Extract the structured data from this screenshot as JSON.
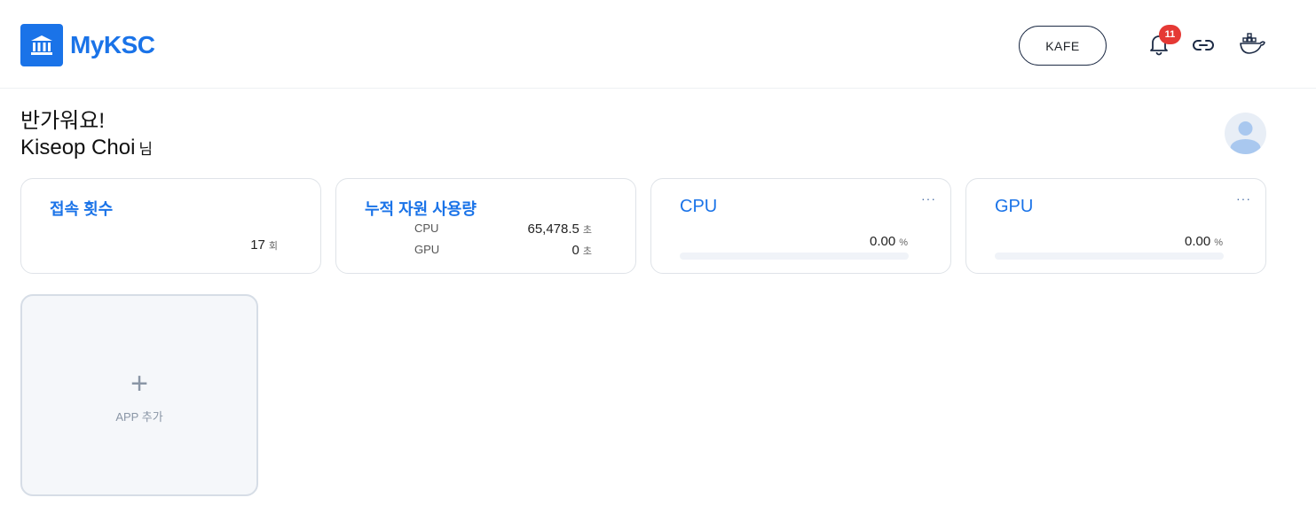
{
  "header": {
    "logo_text": "MyKSC",
    "project_label": "KAFE",
    "notification_count": "11",
    "icons": [
      "bank-icon",
      "bell-icon",
      "link-icon",
      "docker-icon"
    ]
  },
  "greeting": {
    "hello": "반가워요!",
    "user_name": "Kiseop Choi",
    "honorific": "님"
  },
  "cards": {
    "access": {
      "title": "접속 횟수",
      "value": "17",
      "unit": "회"
    },
    "usage": {
      "title": "누적 자원 사용량",
      "rows": [
        {
          "label": "CPU",
          "value": "65,478.5",
          "unit": "초"
        },
        {
          "label": "GPU",
          "value": "0",
          "unit": "초"
        }
      ]
    },
    "cpu": {
      "title": "CPU",
      "more": "···",
      "value": "0.00",
      "unit": "%",
      "fraction": 0.0
    },
    "gpu": {
      "title": "GPU",
      "more": "···",
      "value": "0.00",
      "unit": "%",
      "fraction": 0.0
    }
  },
  "app_add": {
    "label": "APP 추가"
  },
  "colors": {
    "accent": "#1a73e8",
    "badge": "#e53935"
  }
}
